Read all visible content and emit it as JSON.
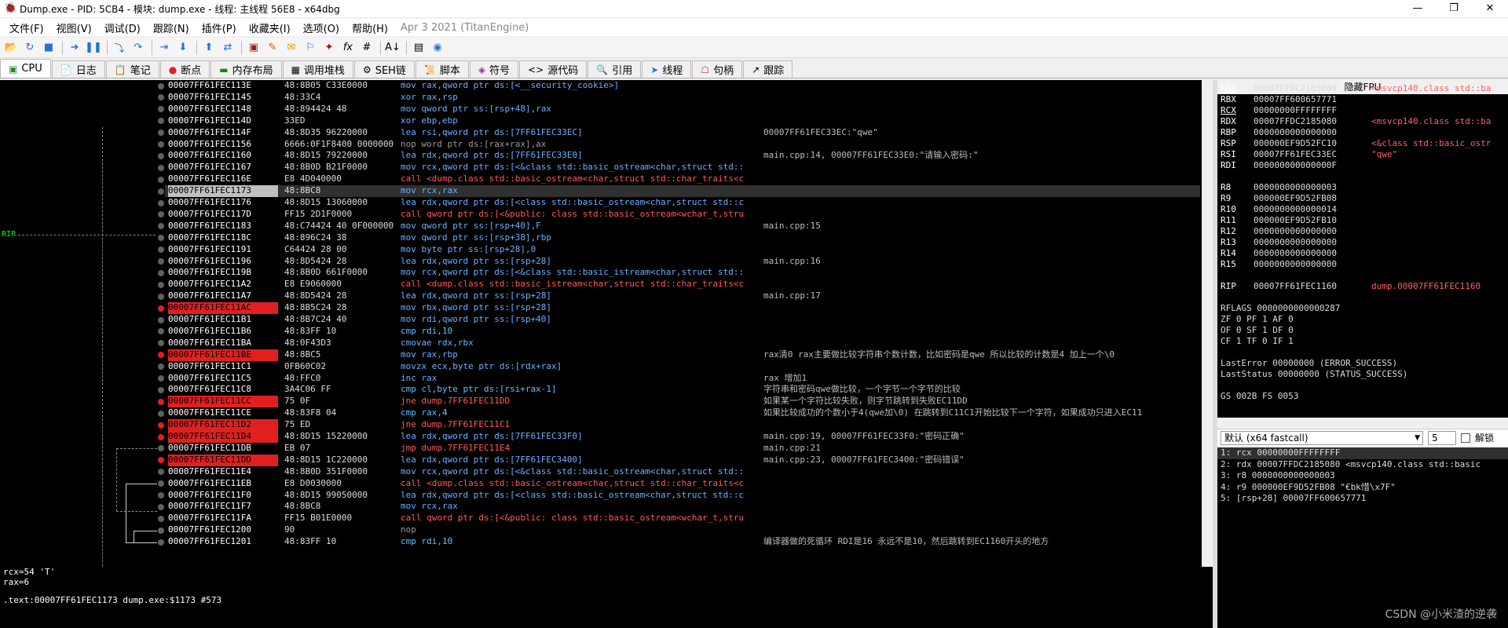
{
  "window": {
    "title": "Dump.exe - PID: 5CB4 - 模块: dump.exe - 线程: 主线程 56E8 - x64dbg",
    "controls": [
      "—",
      "❐",
      "✕"
    ]
  },
  "menu": {
    "items": [
      "文件(F)",
      "视图(V)",
      "调试(D)",
      "跟踪(N)",
      "插件(P)",
      "收藏夹(I)",
      "选项(O)",
      "帮助(H)"
    ],
    "engine": "Apr 3 2021 (TitanEngine)"
  },
  "toolbar": {
    "icons": [
      "open-icon",
      "restart-icon",
      "stop-icon",
      "run-icon",
      "pause-icon",
      "step-into-icon",
      "step-over-icon",
      "trace-into-icon",
      "trace-over-icon",
      "execute-till-return-icon",
      "run-to-user-icon",
      "patch-icon",
      "comment-icon",
      "label-icon",
      "bookmark-icon",
      "function-icon",
      "fx-icon",
      "hash-icon",
      "font-icon",
      "calculator-icon",
      "globe-icon"
    ]
  },
  "tabs": [
    {
      "label": "CPU",
      "icon": "cpu-icon",
      "active": true
    },
    {
      "label": "日志",
      "icon": "log-icon"
    },
    {
      "label": "笔记",
      "icon": "notes-icon"
    },
    {
      "label": "断点",
      "icon": "breakpoint-icon"
    },
    {
      "label": "内存布局",
      "icon": "memory-icon"
    },
    {
      "label": "调用堆栈",
      "icon": "callstack-icon"
    },
    {
      "label": "SEH链",
      "icon": "seh-icon"
    },
    {
      "label": "脚本",
      "icon": "script-icon"
    },
    {
      "label": "符号",
      "icon": "symbol-icon"
    },
    {
      "label": "源代码",
      "icon": "source-icon"
    },
    {
      "label": "引用",
      "icon": "reference-icon"
    },
    {
      "label": "线程",
      "icon": "thread-icon"
    },
    {
      "label": "句柄",
      "icon": "handle-icon"
    },
    {
      "label": "跟踪",
      "icon": "trace-icon"
    }
  ],
  "rip_label": "RIP",
  "disasm": [
    {
      "addr": "00007FF61FEC113E",
      "bytes": "48:8B05 C33E0000",
      "ins": "mov rax,qword ptr ds:[<__security_cookie>]",
      "cmt": ""
    },
    {
      "addr": "00007FF61FEC1145",
      "bytes": "48:33C4",
      "ins": "xor rax,rsp",
      "cmt": ""
    },
    {
      "addr": "00007FF61FEC1148",
      "bytes": "48:894424 48",
      "ins": "mov qword ptr ss:[rsp+48],rax",
      "cmt": ""
    },
    {
      "addr": "00007FF61FEC114D",
      "bytes": "33ED",
      "ins": "xor ebp,ebp",
      "cmt": ""
    },
    {
      "addr": "00007FF61FEC114F",
      "bytes": "48:8D35 96220000",
      "ins": "lea rsi,qword ptr ds:[7FF61FEC33EC]",
      "cmt": "00007FF61FEC33EC:\"qwe\""
    },
    {
      "addr": "00007FF61FEC1156",
      "bytes": "6666:0F1F8400 0000000",
      "ins": "nop word ptr ds:[rax+rax],ax",
      "cmt": ""
    },
    {
      "addr": "00007FF61FEC1160",
      "bytes": "48:8D15 79220000",
      "ins": "lea rdx,qword ptr ds:[7FF61FEC33E0]",
      "cmt": "main.cpp:14, 00007FF61FEC33E0:\"请输入密码:\""
    },
    {
      "addr": "00007FF61FEC1167",
      "bytes": "48:8B0D B21F0000",
      "ins": "mov rcx,qword ptr ds:[<&class std::basic_ostream<char,struct std::",
      "cmt": ""
    },
    {
      "addr": "00007FF61FEC116E",
      "bytes": "E8 4D040000",
      "ins": "call <dump.class std::basic_ostream<char,struct std::char_traits<c",
      "cmt": ""
    },
    {
      "addr": "00007FF61FEC1173",
      "bytes": "48:8BC8",
      "ins": "mov rcx,rax",
      "cmt": ""
    },
    {
      "addr": "00007FF61FEC1176",
      "bytes": "48:8D15 13060000",
      "ins": "lea rdx,qword ptr ds:[<class std::basic_ostream<char,struct std::c",
      "cmt": ""
    },
    {
      "addr": "00007FF61FEC117D",
      "bytes": "FF15 2D1F0000",
      "ins": "call qword ptr ds:[<&public: class std::basic_ostream<wchar_t,stru",
      "cmt": ""
    },
    {
      "addr": "00007FF61FEC1183",
      "bytes": "48:C74424 40 0F000000",
      "ins": "mov qword ptr ss:[rsp+40],F",
      "cmt": "main.cpp:15"
    },
    {
      "addr": "00007FF61FEC118C",
      "bytes": "48:896C24 38",
      "ins": "mov qword ptr ss:[rsp+38],rbp",
      "cmt": ""
    },
    {
      "addr": "00007FF61FEC1191",
      "bytes": "C64424 28 00",
      "ins": "mov byte ptr ss:[rsp+28],0",
      "cmt": ""
    },
    {
      "addr": "00007FF61FEC1196",
      "bytes": "48:8D5424 28",
      "ins": "lea rdx,qword ptr ss:[rsp+28]",
      "cmt": "main.cpp:16"
    },
    {
      "addr": "00007FF61FEC119B",
      "bytes": "48:8B0D 661F0000",
      "ins": "mov rcx,qword ptr ds:[<&class std::basic_istream<char,struct std::",
      "cmt": ""
    },
    {
      "addr": "00007FF61FEC11A2",
      "bytes": "E8 E9060000",
      "ins": "call <dump.class std::basic_istream<char,struct std::char_traits<c",
      "cmt": ""
    },
    {
      "addr": "00007FF61FEC11A7",
      "bytes": "48:8D5424 28",
      "ins": "lea rdx,qword ptr ss:[rsp+28]",
      "cmt": "main.cpp:17"
    },
    {
      "addr": "00007FF61FEC11AC",
      "bytes": "48:8B5C24 28",
      "ins": "mov rbx,qword ptr ss:[rsp+28]",
      "cmt": ""
    },
    {
      "addr": "00007FF61FEC11B1",
      "bytes": "48:8B7C24 40",
      "ins": "mov rdi,qword ptr ss:[rsp+40]",
      "cmt": ""
    },
    {
      "addr": "00007FF61FEC11B6",
      "bytes": "48:83FF 10",
      "ins": "cmp rdi,10",
      "cmt": ""
    },
    {
      "addr": "00007FF61FEC11BA",
      "bytes": "48:0F43D3",
      "ins": "cmovae rdx,rbx",
      "cmt": ""
    },
    {
      "addr": "00007FF61FEC11BE",
      "bytes": "48:8BC5",
      "ins": "mov rax,rbp",
      "cmt": "rax清0 rax主要做比较字符串个数计数，比如密码是qwe 所以比较的计数是4 加上一个\\0"
    },
    {
      "addr": "00007FF61FEC11C1",
      "bytes": "0FB60C02",
      "ins": "movzx ecx,byte ptr ds:[rdx+rax]",
      "cmt": ""
    },
    {
      "addr": "00007FF61FEC11C5",
      "bytes": "48:FFC0",
      "ins": "inc rax",
      "cmt": "rax 增加1"
    },
    {
      "addr": "00007FF61FEC11C8",
      "bytes": "3A4C06 FF",
      "ins": "cmp cl,byte ptr ds:[rsi+rax-1]",
      "cmt": "字符串和密码qwe做比较，一个字节一个字节的比较"
    },
    {
      "addr": "00007FF61FEC11CC",
      "bytes": "75 0F",
      "ins": "jne dump.7FF61FEC11DD",
      "cmt": "如果某一个字符比较失败，则字节跳转到失败EC11DD"
    },
    {
      "addr": "00007FF61FEC11CE",
      "bytes": "48:83F8 04",
      "ins": "cmp rax,4",
      "cmt": "如果比较成功的个数小于4(qwe加\\0) 在跳转到C11C1开始比较下一个字符，如果成功只进入EC11"
    },
    {
      "addr": "00007FF61FEC11D2",
      "bytes": "75 ED",
      "ins": "jne dump.7FF61FEC11C1",
      "cmt": ""
    },
    {
      "addr": "00007FF61FEC11D4",
      "bytes": "48:8D15 15220000",
      "ins": "lea rdx,qword ptr ds:[7FF61FEC33F0]",
      "cmt": "main.cpp:19, 00007FF61FEC33F0:\"密码正确\""
    },
    {
      "addr": "00007FF61FEC11DB",
      "bytes": "EB 07",
      "ins": "jmp dump.7FF61FEC11E4",
      "cmt": "main.cpp:21"
    },
    {
      "addr": "00007FF61FEC11DD",
      "bytes": "48:8D15 1C220000",
      "ins": "lea rdx,qword ptr ds:[7FF61FEC3400]",
      "cmt": "main.cpp:23, 00007FF61FEC3400:\"密码错误\""
    },
    {
      "addr": "00007FF61FEC11E4",
      "bytes": "48:8B0D 351F0000",
      "ins": "mov rcx,qword ptr ds:[<&class std::basic_ostream<char,struct std::",
      "cmt": ""
    },
    {
      "addr": "00007FF61FEC11EB",
      "bytes": "E8 D0030000",
      "ins": "call <dump.class std::basic_ostream<char,struct std::char_traits<c",
      "cmt": ""
    },
    {
      "addr": "00007FF61FEC11F0",
      "bytes": "48:8D15 99050000",
      "ins": "lea rdx,qword ptr ds:[<class std::basic_ostream<char,struct std::c",
      "cmt": ""
    },
    {
      "addr": "00007FF61FEC11F7",
      "bytes": "48:8BC8",
      "ins": "mov rcx,rax",
      "cmt": ""
    },
    {
      "addr": "00007FF61FEC11FA",
      "bytes": "FF15 B01E0000",
      "ins": "call qword ptr ds:[<&public: class std::basic_ostream<wchar_t,stru",
      "cmt": ""
    },
    {
      "addr": "00007FF61FEC1200",
      "bytes": "90",
      "ins": "nop",
      "cmt": ""
    },
    {
      "addr": "00007FF61FEC1201",
      "bytes": "48:83FF 10",
      "ins": "cmp rdi,10",
      "cmt": "编译器做的死循环 RDI是16 永远不是10，然后跳转到EC1160开头的地方"
    }
  ],
  "breakpoint_addrs": [
    "00007FF61FEC11AC",
    "00007FF61FEC11BE",
    "00007FF61FEC11CC",
    "00007FF61FEC11D2",
    "00007FF61FEC11D4",
    "00007FF61FEC11DD"
  ],
  "registers": {
    "header": "隐藏FPU",
    "gp": [
      {
        "n": "RAX",
        "v": "00007FFDC2185080",
        "c": "<msvcp140.class std::ba"
      },
      {
        "n": "RBX",
        "v": "00007FF600657771",
        "c": ""
      },
      {
        "n": "RCX",
        "v": "00000000FFFFFFFF",
        "c": ""
      },
      {
        "n": "RDX",
        "v": "00007FFDC2185080",
        "c": "<msvcp140.class std::ba"
      },
      {
        "n": "RBP",
        "v": "0000000000000000",
        "c": ""
      },
      {
        "n": "RSP",
        "v": "000000EF9D52FC10",
        "c": "<&class std::basic_ostr"
      },
      {
        "n": "RSI",
        "v": "00007FF61FEC33EC",
        "c": "\"qwe\""
      },
      {
        "n": "RDI",
        "v": "000000000000000F",
        "c": ""
      }
    ],
    "ext": [
      {
        "n": "R8",
        "v": "0000000000000003"
      },
      {
        "n": "R9",
        "v": "000000EF9D52FB08"
      },
      {
        "n": "R10",
        "v": "0000000000000014"
      },
      {
        "n": "R11",
        "v": "000000EF9D52FB10"
      },
      {
        "n": "R12",
        "v": "0000000000000000"
      },
      {
        "n": "R13",
        "v": "0000000000000000"
      },
      {
        "n": "R14",
        "v": "0000000000000000"
      },
      {
        "n": "R15",
        "v": "0000000000000000"
      }
    ],
    "rip": {
      "n": "RIP",
      "v": "00007FF61FEC1160",
      "c": "dump.00007FF61FEC1160"
    },
    "rflags": "RFLAGS   0000000000000287",
    "flags1": "ZF 0  PF 1  AF 0",
    "flags2": "OF 0  SF 1  DF 0",
    "flags3": "CF 1  TF 0  IF 1",
    "lasterror": "LastError   00000000 (ERROR_SUCCESS)",
    "laststatus": "LastStatus 00000000 (STATUS_SUCCESS)",
    "seg": "GS 002B  FS 0053"
  },
  "callconv": {
    "selected": "默认 (x64 fastcall)",
    "count": "5",
    "unlock_label": "解锁"
  },
  "stack_args": [
    "1: rcx 00000000FFFFFFFF",
    "2: rdx 00007FFDC2185080 <msvcp140.class std::basic",
    "3: r8 0000000000000003",
    "4: r9 000000EF9D52FB08 \"€bk惜\\x7F\"",
    "5: [rsp+28] 00007FF600657771"
  ],
  "log": {
    "line1": "rcx=54 'T'",
    "line2": "rax=6",
    "line3": ".text:00007FF61FEC1173 dump.exe:$1173 #573"
  },
  "watermark": "CSDN @小米渣的逆袭"
}
